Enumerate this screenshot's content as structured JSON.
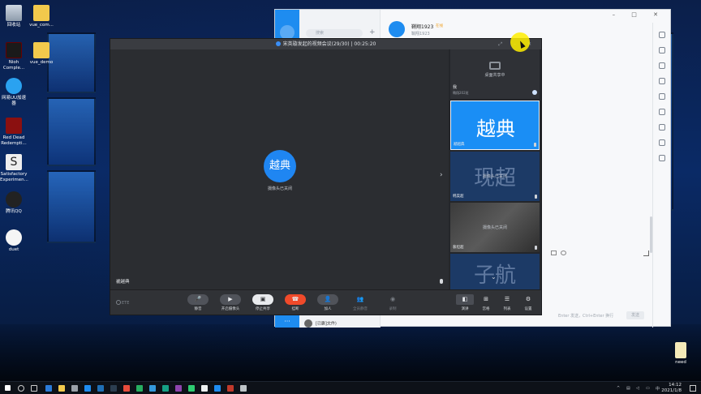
{
  "desktop": {
    "icons": [
      {
        "label": "回收站"
      },
      {
        "label": "vue_com..."
      },
      {
        "label": "Nioh Comple..."
      },
      {
        "label": "vue_demo"
      },
      {
        "label": "网易UU加速器"
      },
      {
        "label": "Red Dead Redempti..."
      },
      {
        "label": "Satisfactory Experimen..."
      },
      {
        "label": "腾讯QQ"
      },
      {
        "label": "duet"
      },
      {
        "label": "need"
      }
    ]
  },
  "chat": {
    "search_placeholder": "搜索",
    "plus": "+",
    "contact_name": "鞘翔1923",
    "contact_tag": "在线",
    "contact_sub": "鞘翔1923",
    "window_controls": "– □ ✕",
    "send_hint": "Enter 发送，Ctrl+Enter 换行",
    "send_label": "发送",
    "last_message": "[已删]文件)",
    "more_dots": "···"
  },
  "meeting": {
    "title": "宋英璇发起的视频会议(29/30) | 00:25:20",
    "title_controls": "⤢ – ✕",
    "main": {
      "avatar_text": "越典",
      "camera_off": "摄像头已关闭",
      "name": "褫越典",
      "expand": "›"
    },
    "side_tiles": [
      {
        "name": "我",
        "sub": "鞘翔202班",
        "status": "桌面共享中"
      },
      {
        "name": "褫越典",
        "avatar_text": "越典"
      },
      {
        "name": "韩昊超",
        "camera_off": "摄像头已关闭",
        "watermark": "现超"
      },
      {
        "name": "裴坦超",
        "camera_off": "摄像头已关闭"
      },
      {
        "name": "",
        "watermark": "子航"
      }
    ],
    "collapse": "⌄",
    "toolbar": {
      "logo": "ETE",
      "buttons": [
        {
          "label": "静音",
          "icon": "microphone-icon",
          "glyph": "🎤"
        },
        {
          "label": "开启摄像头",
          "icon": "camera-icon",
          "glyph": "▶"
        },
        {
          "label": "停止共享",
          "icon": "screen-share-icon",
          "glyph": "▣"
        },
        {
          "label": "挂断",
          "icon": "hangup-icon",
          "glyph": "☎"
        },
        {
          "label": "加人",
          "icon": "add-person-icon",
          "glyph": "👤"
        },
        {
          "label": "全员静音",
          "icon": "mute-all-icon",
          "glyph": "👥"
        },
        {
          "label": "录制",
          "icon": "record-icon",
          "glyph": "◉"
        }
      ],
      "view_buttons": [
        {
          "label": "演讲",
          "icon": "speaker-view-icon",
          "glyph": "◧"
        },
        {
          "label": "宫格",
          "icon": "grid-view-icon",
          "glyph": "⊞"
        },
        {
          "label": "列表",
          "icon": "list-view-icon",
          "glyph": "☰"
        },
        {
          "label": "设置",
          "icon": "settings-icon",
          "glyph": "⚙"
        }
      ]
    }
  },
  "taskbar": {
    "time": "14:12",
    "date": "2021/1/8"
  },
  "colors": {
    "accent": "#1f86f2",
    "hangup": "#f04a2a",
    "meeting_bg": "#2b2d31",
    "cursor_highlight": "#ffee00"
  }
}
